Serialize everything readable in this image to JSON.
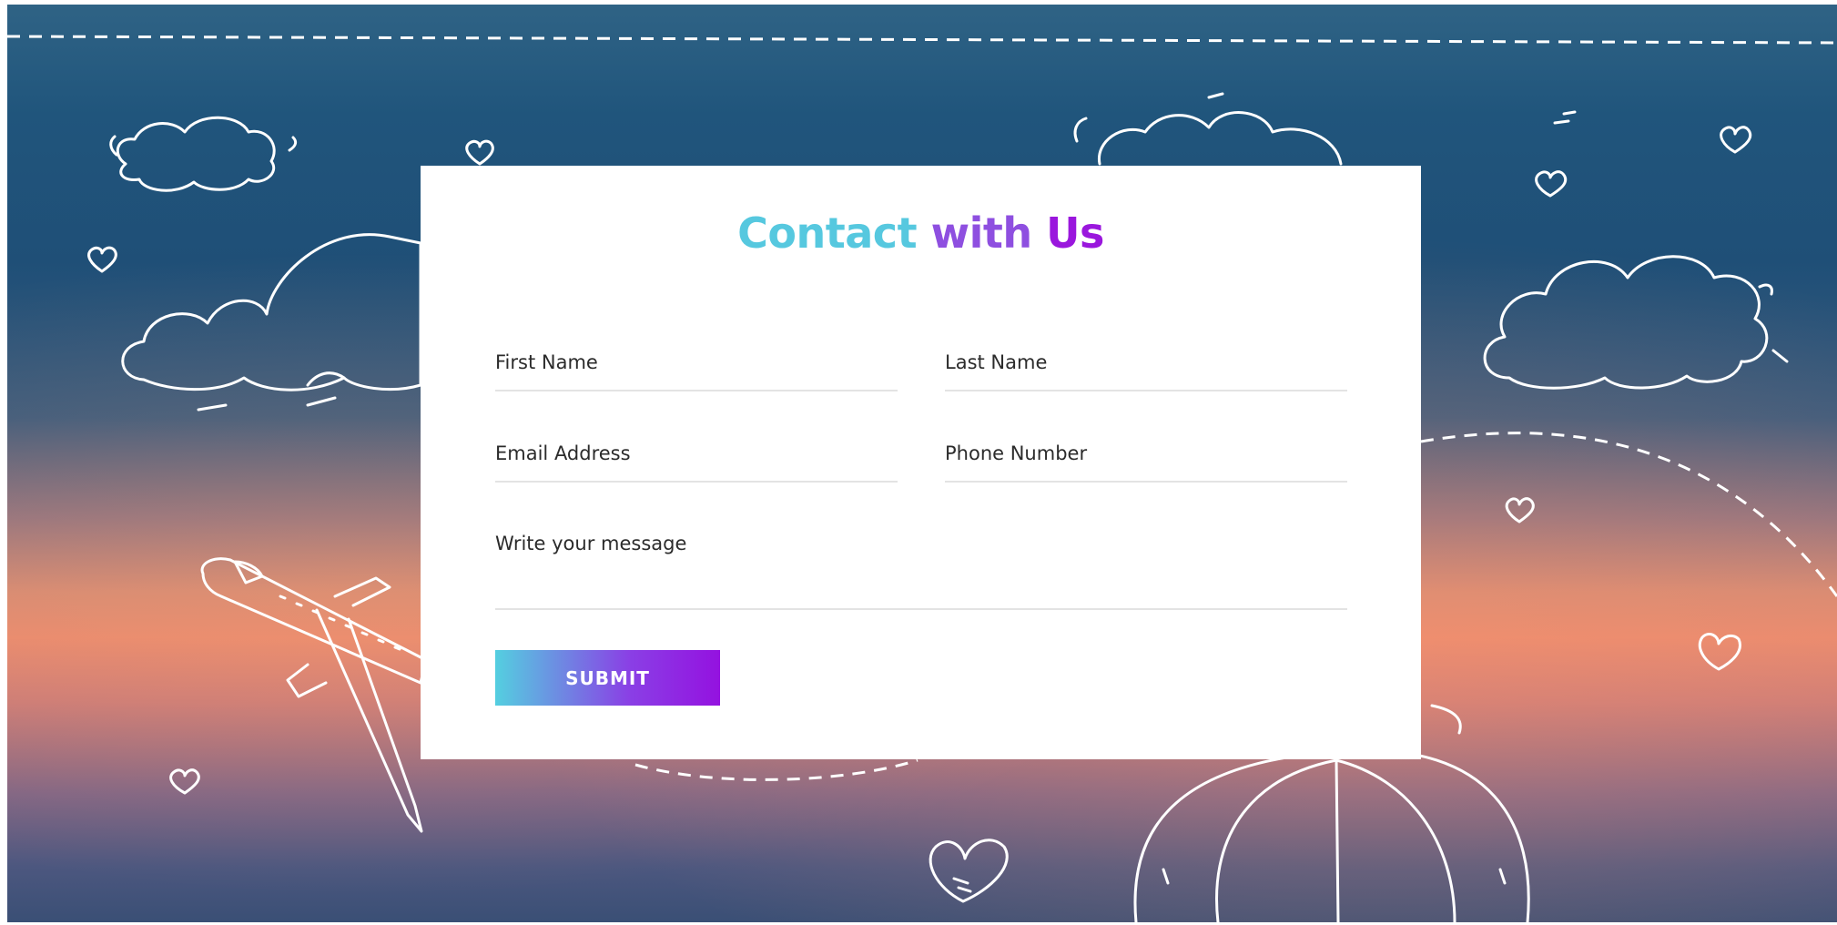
{
  "form": {
    "title_part_1": "Contact",
    "title_part_2": "with",
    "title_part_3": "Us",
    "first_name_placeholder": "First Name",
    "last_name_placeholder": "Last Name",
    "email_placeholder": "Email Address",
    "phone_placeholder": "Phone Number",
    "message_placeholder": "Write your message",
    "submit_label": "SUBMIT"
  },
  "background": {
    "illustrations": [
      "cloud-icon",
      "heart-icon",
      "airplane-icon",
      "hot-air-balloon-icon",
      "dashed-flight-path"
    ]
  },
  "colors": {
    "gradient_start": "#54cfe0",
    "gradient_end": "#9412e0",
    "card_background": "#ffffff",
    "field_underline": "#e3e3e3"
  }
}
